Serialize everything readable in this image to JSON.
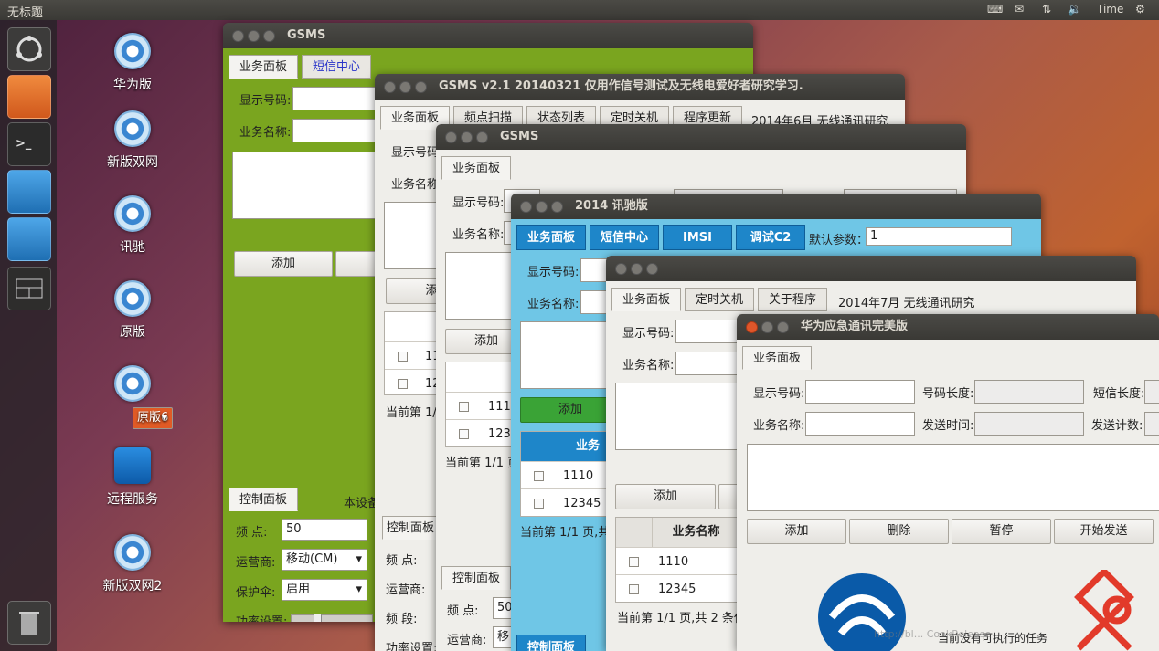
{
  "topbar": {
    "title": "无标题",
    "time": "Time",
    "icons": [
      "keyboard-icon",
      "mail-icon",
      "network-icon",
      "volume-icon",
      "gear-icon"
    ]
  },
  "launcher": {
    "items": [
      "ubuntu-logo-icon",
      "files-icon",
      "terminal-icon",
      "chromium-icon",
      "chromium-icon",
      "workspace-icon",
      "trash-icon"
    ]
  },
  "desktop": {
    "icons": [
      "华为版",
      "新版双网",
      "讯驰",
      "原版",
      "原版6",
      "远程服务",
      "新版双网2"
    ]
  },
  "w1": {
    "title": "GSMS",
    "tabs": [
      "业务面板",
      "短信中心"
    ],
    "show_no": "显示号码:",
    "biz_name": "业务名称:",
    "add": "添加",
    "ctrl_tab": "控制面板",
    "device": "本设备",
    "freq_lbl": "频 点:",
    "freq_val": "50",
    "op_lbl": "运营商:",
    "op_val": "移动(CM)",
    "prot_lbl": "保护伞:",
    "prot_val": "启用",
    "power_lbl": "功率设置:",
    "color": "#7aa51f"
  },
  "w2": {
    "title": "GSMS v2.1 20140321 仅用作信号测试及无线电爱好者研究学习.",
    "tabs": [
      "业务面板",
      "频点扫描",
      "状态列表",
      "定时关机",
      "程序更新"
    ],
    "tab_note": "2014年6月 无线通讯研究",
    "show_no": "显示号码",
    "biz_name": "业务名称",
    "add": "添",
    "rows": [
      "111",
      "123"
    ],
    "page": "当前第 1/1",
    "ctrl_tab": "控制面板",
    "freq": "频 点:",
    "op": "运营商:",
    "band": "频 段:",
    "power": "功率设置:"
  },
  "w3": {
    "title": "GSMS",
    "tab": "业务面板",
    "show_no": "显示号码:",
    "biz_name": "业务名称:",
    "add": "添加",
    "rows": [
      "1110",
      "1234"
    ],
    "page": "当前第 1/1 页",
    "ctrl_tab": "控制面板",
    "freq_lbl": "频 点:",
    "freq_val": "50",
    "op_lbl": "运营商:",
    "op_val": "移"
  },
  "w4": {
    "title": "2014 讯驰版",
    "tabs": [
      "业务面板",
      "短信中心",
      "IMSI",
      "调试C2"
    ],
    "def_lbl": "默认参数：",
    "def_val": "1",
    "show_no": "显示号码:",
    "biz_name": "业务名称:",
    "add": "添加",
    "th": "业务",
    "rows": [
      "1110",
      "12345"
    ],
    "page": "当前第 1/1 页,共",
    "ctrl_tab": "控制面板",
    "accent": "#1e86c9",
    "bg": "#6fc6e6",
    "green": "#3aa336"
  },
  "w5": {
    "tabs": [
      "业务面板",
      "定时关机",
      "关于程序"
    ],
    "tab_note": "2014年7月 无线通讯研究",
    "show_no": "显示号码:",
    "biz_name": "业务名称:",
    "add": "添加",
    "th": "业务名称",
    "rows": [
      "1110",
      "12345"
    ],
    "page": "当前第 1/1 页,共 2 条任务"
  },
  "w6": {
    "title": "华为应急通讯完美版",
    "tab": "业务面板",
    "show_no": "显示号码:",
    "len_lbl": "号码长度:",
    "sms_len": "短信长度:",
    "biz_name": "业务名称:",
    "send_time": "发送时间:",
    "send_count": "发送计数:",
    "buttons": [
      "添加",
      "删除",
      "暂停",
      "开始发送"
    ],
    "status": "当前没有可执行的任务",
    "watermark": "http://bl... CookRelease"
  }
}
